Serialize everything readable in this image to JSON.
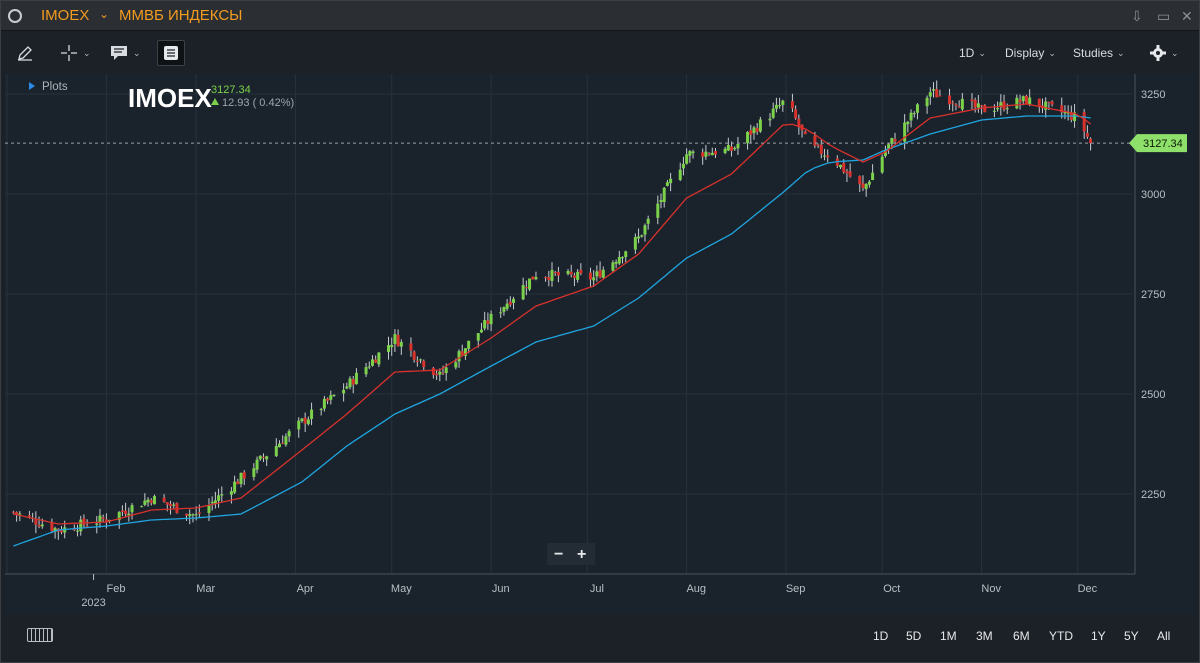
{
  "window": {
    "symbol": "IMOEX",
    "description": "ММВБ ИНДЕКСЫ",
    "controls": [
      "⇩",
      "▭",
      "✕"
    ]
  },
  "toolbar": {
    "draw_icon": "pencil-icon",
    "crosshair_icon": "crosshair-icon",
    "comment_icon": "comment-icon",
    "table_icon": "table-icon",
    "interval": "1D",
    "display": "Display",
    "studies": "Studies",
    "settings_icon": "gear-icon"
  },
  "legend": {
    "plots_label": "Plots",
    "symbol": "IMOEX",
    "last": "3127.34",
    "change": "12.93 ( 0.42%)",
    "up_color": "#7bd14a"
  },
  "price_axis": {
    "ticks": [
      "3250",
      "3000",
      "2750",
      "2500",
      "2250"
    ],
    "last_price_label": "3127.34",
    "last_label_color": "#8ee06a"
  },
  "time_axis": {
    "labels": [
      "2023",
      "Feb",
      "Mar",
      "Apr",
      "May",
      "Jun",
      "Jul",
      "Aug",
      "Sep",
      "Oct",
      "Nov",
      "Dec"
    ]
  },
  "zoom": {
    "minus": "−",
    "plus": "+"
  },
  "ranges": [
    "1D",
    "5D",
    "1M",
    "3M",
    "6M",
    "YTD",
    "1Y",
    "5Y",
    "All"
  ],
  "colors": {
    "up": "#7bd14a",
    "down": "#d8322c",
    "ma_fast": "#d9312b",
    "ma_slow": "#1fa5e0",
    "accent": "#f39c1f"
  },
  "chart_data": {
    "type": "line",
    "x": [
      "Jan 3",
      "Jan 17",
      "Feb 1",
      "Feb 15",
      "Mar 1",
      "Mar 15",
      "Apr 3",
      "Apr 17",
      "May 2",
      "May 16",
      "Jun 1",
      "Jun 15",
      "Jul 3",
      "Jul 17",
      "Aug 1",
      "Aug 15",
      "Sep 1",
      "Sep 8",
      "Sep 15",
      "Sep 25",
      "Oct 2",
      "Oct 16",
      "Nov 1",
      "Nov 15",
      "Dec 1",
      "Dec 5"
    ],
    "series": [
      {
        "values": [
          2205,
          2160,
          2188,
          2240,
          2195,
          2290,
          2430,
          2520,
          2640,
          2545,
          2690,
          2800,
          2790,
          2890,
          3100,
          3110,
          3235,
          3120,
          3095,
          3010,
          3110,
          3255,
          3210,
          3235,
          3190,
          3127.34
        ]
      },
      {
        "values": [
          2200,
          2175,
          2180,
          2210,
          2215,
          2240,
          2360,
          2450,
          2555,
          2560,
          2640,
          2720,
          2770,
          2850,
          2990,
          3050,
          3180,
          3160,
          3120,
          3080,
          3105,
          3190,
          3215,
          3225,
          3200,
          3175
        ]
      },
      {
        "values": [
          2120,
          2160,
          2170,
          2185,
          2190,
          2200,
          2280,
          2370,
          2450,
          2500,
          2570,
          2630,
          2670,
          2740,
          2840,
          2900,
          3010,
          3060,
          3080,
          3085,
          3110,
          3150,
          3185,
          3195,
          3195,
          3190
        ]
      }
    ],
    "ylim": [
      2050,
      3300
    ],
    "yticks": [
      2250,
      2500,
      2750,
      3000,
      3250
    ],
    "grid": true
  }
}
